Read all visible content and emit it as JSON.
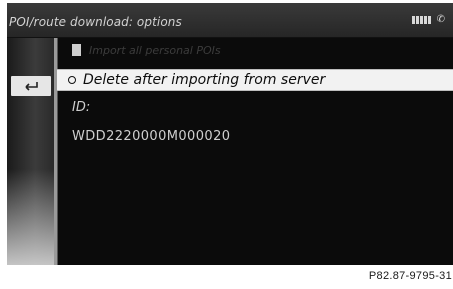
{
  "header": {
    "title": "POI/route download: options",
    "icons": [
      "signal-strength-icon",
      "phone-icon"
    ]
  },
  "sidebar": {
    "back_icon": "back-arrow-icon"
  },
  "menu": {
    "item_disabled": "Import all personal POIs",
    "item_selected": "Delete after importing from server"
  },
  "vehicle": {
    "id_label": "ID:",
    "id_value": "WDD2220000M000020"
  },
  "figure": {
    "reference": "P82.87-9795-31"
  },
  "colors": {
    "background": "#0b0b0b",
    "highlight": "#f2f2f2",
    "text": "#cfcfcf"
  }
}
